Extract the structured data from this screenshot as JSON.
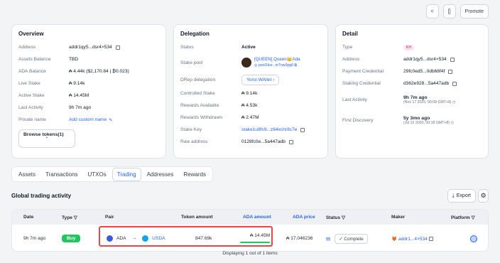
{
  "top_buttons": [
    "<",
    "[]",
    "Promote"
  ],
  "overview": {
    "title": "Overview",
    "rows": [
      {
        "label": "Address",
        "value": "addr1qy5...dsr4×534"
      },
      {
        "label": "Assets Balance",
        "value": "TBD"
      },
      {
        "label": "ADA Balance",
        "value": "₳ 4.44k ($2,170.84 | ₿0.023)"
      },
      {
        "label": "Live Stake",
        "value": "₳ 9.14k"
      },
      {
        "label": "Active Stake",
        "value": "₳ 14.45M"
      },
      {
        "label": "Last Activity",
        "value": "9h 7m ago"
      },
      {
        "label": "Private name",
        "value": "Add custom name"
      }
    ],
    "browse_label": "Browse tokens",
    "browse_count": "(1)",
    "browse_chevron": "⌃"
  },
  "delegation": {
    "title": "Delegation",
    "status_label": "Status",
    "status_value": "Active",
    "pool_label": "Stake pool",
    "pool_name": "[QUEEN] Queen👑Ada",
    "pool_id": "◎ pool1ksr...m7nw3pg0 ⧉",
    "drep_label": "DRep delegation",
    "drep_value": "Yoroi WAllet ›",
    "rows": [
      {
        "label": "Controlled Stake",
        "value": "₳ 9.14k"
      },
      {
        "label": "Rewards Available",
        "value": "₳ 4.53k"
      },
      {
        "label": "Rewards Withdrawn",
        "value": "₳ 2.47M"
      }
    ],
    "stake_key_label": "Stake Key",
    "stake_key_value": "stake1u8fc9...z64xchr8c7e",
    "raw_label": "Raw address",
    "raw_value": "0128fc0e...5a447adb"
  },
  "detail": {
    "title": "Detail",
    "type_label": "Type",
    "type_value": "KH",
    "rows": [
      {
        "label": "Address",
        "value": "addr1qy5...dsr4×534"
      },
      {
        "label": "Payment Credential",
        "value": "29fc0ed5...0db68f4f"
      },
      {
        "label": "Staking Credential",
        "value": "d362e928...5a447adb"
      }
    ],
    "last_label": "Last Activity",
    "last_value": "9h 7m ago",
    "last_sub": "(Nov 17 2025, 00:08 GMT+8) ◷",
    "first_label": "First Discovery",
    "first_value": "5y 3mo ago",
    "first_sub": "(Jul 31 2020, 00:18 GMT+8) ◷"
  },
  "tabs": [
    "Assets",
    "Transactions",
    "UTXOs",
    "Trading",
    "Addresses",
    "Rewards"
  ],
  "section_title": "Global trading activity",
  "export_label": "Export",
  "table": {
    "headers": {
      "date": "Date",
      "type": "Type ▽",
      "pair": "Pair",
      "token_amount": "Token amount",
      "ada_amount": "ADA amount",
      "ada_price": "ADA price",
      "status": "Status ▽",
      "maker": "Maker",
      "platform": "Platform ▽"
    },
    "row": {
      "date": "9h 7m ago",
      "type": "Buy",
      "pair_from": "ADA",
      "arrow": "→",
      "pair_to": "USDA",
      "token_amount": "847.69k",
      "ada_amount": "₳ 14.45M",
      "ada_price": "₳ 17.046236",
      "status": "✓ Complete",
      "maker": "🦊 addr1...4×534"
    },
    "ada_amount_fraction": 1.0
  },
  "footer": "Displaying 1 out of 1 items",
  "colors": {
    "accent": "#2563eb",
    "buy": "#22c55e",
    "highlight": "#ef4444"
  }
}
